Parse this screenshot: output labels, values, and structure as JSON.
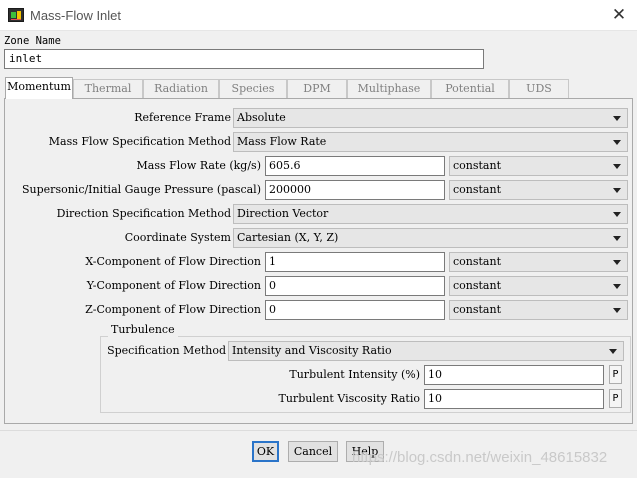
{
  "window": {
    "title": "Mass-Flow Inlet",
    "close_glyph": "✕"
  },
  "zone": {
    "label": "Zone Name",
    "value": "inlet"
  },
  "tabs": [
    {
      "label": "Momentum",
      "active": true
    },
    {
      "label": "Thermal"
    },
    {
      "label": "Radiation"
    },
    {
      "label": "Species"
    },
    {
      "label": "DPM"
    },
    {
      "label": "Multiphase"
    },
    {
      "label": "Potential"
    },
    {
      "label": "UDS"
    }
  ],
  "momentum": {
    "reference_frame": {
      "label": "Reference Frame",
      "value": "Absolute"
    },
    "mass_flow_spec_method": {
      "label": "Mass Flow Specification Method",
      "value": "Mass Flow Rate"
    },
    "mass_flow_rate": {
      "label": "Mass Flow Rate (kg/s)",
      "value": "605.6",
      "option": "constant"
    },
    "gauge_pressure": {
      "label": "Supersonic/Initial Gauge Pressure (pascal)",
      "value": "200000",
      "option": "constant"
    },
    "direction_spec_method": {
      "label": "Direction Specification Method",
      "value": "Direction Vector"
    },
    "coordinate_system": {
      "label": "Coordinate System",
      "value": "Cartesian (X, Y, Z)"
    },
    "x_component": {
      "label": "X-Component of Flow Direction",
      "value": "1",
      "option": "constant"
    },
    "y_component": {
      "label": "Y-Component of Flow Direction",
      "value": "0",
      "option": "constant"
    },
    "z_component": {
      "label": "Z-Component of Flow Direction",
      "value": "0",
      "option": "constant"
    }
  },
  "turbulence": {
    "title": "Turbulence",
    "spec_method": {
      "label": "Specification Method",
      "value": "Intensity and Viscosity Ratio"
    },
    "intensity": {
      "label": "Turbulent Intensity (%)",
      "value": "10",
      "p_label": "P"
    },
    "viscosity_ratio": {
      "label": "Turbulent Viscosity Ratio",
      "value": "10",
      "p_label": "P"
    }
  },
  "buttons": {
    "ok": "OK",
    "cancel": "Cancel",
    "help": "Help"
  },
  "watermark": "https://blog.csdn.net/weixin_48615832",
  "colors": {
    "accent": "#2a74c9",
    "panel_bg": "#f0f0f0",
    "combo_bg": "#e6e6e6"
  },
  "icons": {
    "app": "fluent-app-icon",
    "close": "close-icon",
    "dropdown": "chevron-down-icon"
  }
}
